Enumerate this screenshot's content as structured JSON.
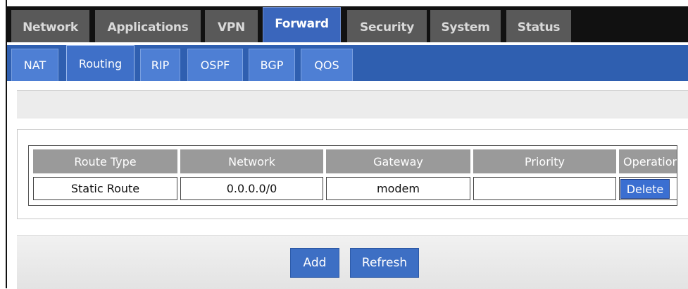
{
  "top_tabs": [
    {
      "label": "Network"
    },
    {
      "label": "Applications"
    },
    {
      "label": "VPN"
    },
    {
      "label": "Forward"
    },
    {
      "label": "Security"
    },
    {
      "label": "System"
    },
    {
      "label": "Status"
    }
  ],
  "active_top_tab": "Forward",
  "sub_tabs": [
    {
      "label": "NAT"
    },
    {
      "label": "Routing"
    },
    {
      "label": "RIP"
    },
    {
      "label": "OSPF"
    },
    {
      "label": "BGP"
    },
    {
      "label": "QOS"
    }
  ],
  "active_sub_tab": "Routing",
  "routes_table": {
    "columns": [
      "Route Type",
      "Network",
      "Gateway",
      "Priority",
      "Operation"
    ],
    "rows": [
      {
        "route_type": "Static Route",
        "network": "0.0.0.0/0",
        "gateway": "modem",
        "priority": "",
        "operation": "Delete"
      }
    ]
  },
  "actions": {
    "add_label": "Add",
    "refresh_label": "Refresh"
  },
  "colors": {
    "active_tab": "#3a66bc",
    "sub_bar": "#2f5fb0",
    "button": "#3d6fc4",
    "header": "#9a9a9a"
  }
}
